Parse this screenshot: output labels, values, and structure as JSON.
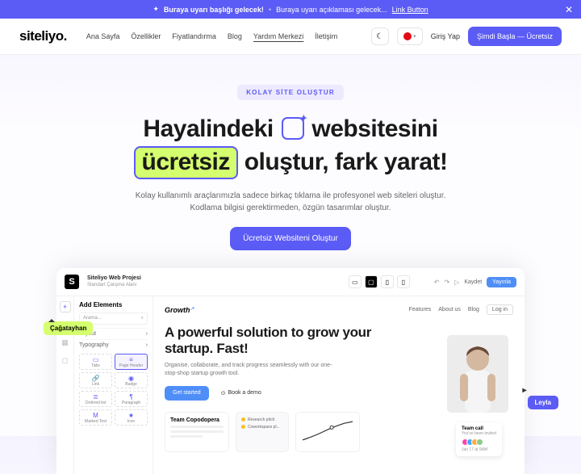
{
  "banner": {
    "title": "Buraya uyarı başlığı gelecek!",
    "desc": "Buraya uyarı açıklaması gelecek...",
    "link": "Link Button"
  },
  "nav": {
    "logo": "siteliyo.",
    "links": [
      "Ana Sayfa",
      "Özellikler",
      "Fiyatlandırma",
      "Blog",
      "Yardım Merkezi",
      "İletişim"
    ],
    "active_index": 4,
    "login": "Giriş Yap",
    "cta": "Şimdi Başla — Ücretsiz"
  },
  "hero": {
    "badge": "KOLAY SİTE OLUŞTUR",
    "line1_pre": "Hayalindeki",
    "line1_post": "websitesini",
    "highlight": "ücretsiz",
    "line2_post": "oluştur, fark yarat!",
    "sub1": "Kolay kullanımlı araçlarımızla sadece birkaç tıklama ile profesyonel web siteleri oluştur.",
    "sub2": "Kodlama bilgisi gerektirmeden, özgün tasarımlar oluştur.",
    "cta": "Ücretsiz Websiteni Oluştur"
  },
  "editor": {
    "project_name": "Siteliyo Web Projesi",
    "project_sub": "Standart Çalışma Alanı",
    "save": "Kaydet",
    "publish": "Yayınla",
    "panel_title": "Add Elements",
    "panel_search": "Arama...",
    "panel_rows": [
      "Layout",
      "Typography"
    ],
    "grid_items": [
      "Tabs",
      "Page Header",
      "Link",
      "Badge",
      "Ordered list",
      "Paragraph",
      "Marked Text",
      "Icon"
    ],
    "canvas": {
      "logo": "Growth",
      "nav": [
        "Features",
        "About us",
        "Blog"
      ],
      "login": "Log in",
      "headline": "A powerful solution to grow your startup. Fast!",
      "sub": "Organise, collaborate, and track progress seamlessly with our one-stop-shop startup growth tool.",
      "primary": "Get started",
      "secondary": "Book a demo",
      "card1_title": "Team Copodopera",
      "card2_items": [
        "Research pitch",
        "Coworkspace pl..."
      ],
      "team_card_title": "Team call",
      "team_card_sub": "You've been invited",
      "team_card_time": "Jan 17 at 9AM"
    }
  },
  "tags": {
    "left": "Çağatayhan",
    "right": "Leyla"
  }
}
